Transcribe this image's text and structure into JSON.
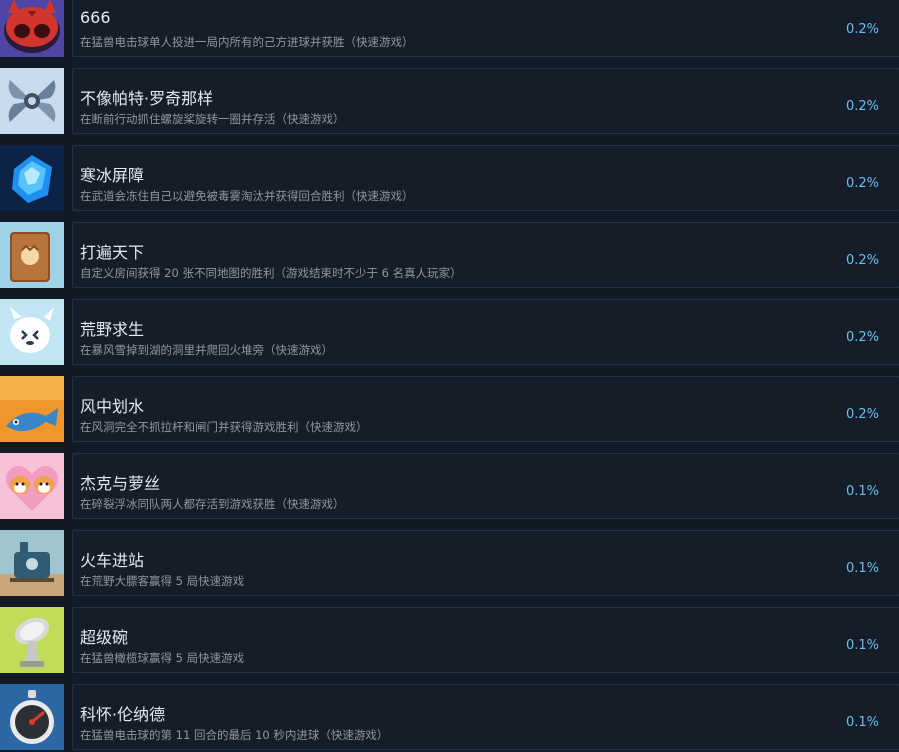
{
  "achievements": [
    {
      "title": "666",
      "description": "在猛兽电击球单人投进一局内所有的己方进球并获胜（快速游戏）",
      "percent": "0.2%",
      "icon": "devil-cat-icon",
      "accent": "#d2342e"
    },
    {
      "title": "不像帕特·罗奇那样",
      "description": "在断前行动抓住螺旋桨旋转一圈并存活（快速游戏）",
      "percent": "0.2%",
      "icon": "propeller-icon",
      "accent": "#8ea6c4"
    },
    {
      "title": "寒冰屏障",
      "description": "在武道会冻住自己以避免被毒雾淘汰并获得回合胜利（快速游戏）",
      "percent": "0.2%",
      "icon": "ice-crystal-icon",
      "accent": "#1f8ff0"
    },
    {
      "title": "打遍天下",
      "description": "自定义房间获得 20 张不同地图的胜利（游戏结束时不少于 6 名真人玩家）",
      "percent": "0.2%",
      "icon": "passport-icon",
      "accent": "#b8743a"
    },
    {
      "title": "荒野求生",
      "description": "在暴风雪掉到湖的洞里并爬回火堆旁（快速游戏）",
      "percent": "0.2%",
      "icon": "snow-creature-icon",
      "accent": "#bfe6f2"
    },
    {
      "title": "风中划水",
      "description": "在风洞完全不抓拉杆和闸门并获得游戏胜利（快速游戏）",
      "percent": "0.2%",
      "icon": "fish-icon",
      "accent": "#f0962a"
    },
    {
      "title": "杰克与萝丝",
      "description": "在碎裂浮冰同队两人都存活到游戏获胜（快速游戏）",
      "percent": "0.1%",
      "icon": "heart-corgis-icon",
      "accent": "#f29cc0"
    },
    {
      "title": "火车进站",
      "description": "在荒野大膘客赢得 5 局快速游戏",
      "percent": "0.1%",
      "icon": "train-icon",
      "accent": "#9fc6cf"
    },
    {
      "title": "超级碗",
      "description": "在猛兽橄榄球赢得 5 局快速游戏",
      "percent": "0.1%",
      "icon": "trophy-icon",
      "accent": "#b5d63b"
    },
    {
      "title": "科怀·伦纳德",
      "description": "在猛兽电击球的第 11 回合的最后 10 秒内进球（快速游戏）",
      "percent": "0.1%",
      "icon": "stopwatch-icon",
      "accent": "#3a7fc0"
    }
  ]
}
